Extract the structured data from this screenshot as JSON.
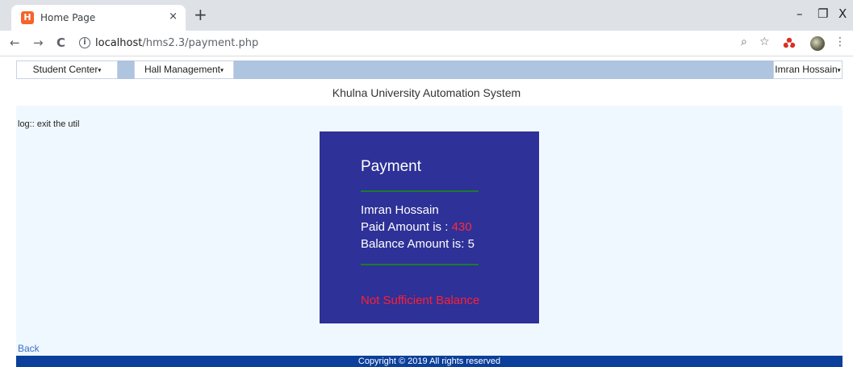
{
  "browser": {
    "tab_title": "Home Page",
    "tab_close": "×",
    "new_tab": "+",
    "favicon_text": "H",
    "url_host": "localhost",
    "url_path": "/hms2.3/payment.php",
    "window_minimize": "–",
    "window_restore": "❐",
    "window_close": "X",
    "back": "←",
    "forward": "→",
    "reload": "C",
    "info": "i",
    "zoom": "⌕",
    "star": "☆",
    "menu": "⋮"
  },
  "navbar": {
    "student_center": "Student Center",
    "hall_management": "Hall Management",
    "user": "Imran Hossain",
    "caret": "▾"
  },
  "site_title": "Khulna University Automation System",
  "log_text": "log:: exit the util",
  "payment": {
    "title": "Payment",
    "name": "Imran Hossain",
    "paid_label": "Paid Amount is : ",
    "paid_value": "430",
    "balance_label": "Balance Amount is: ",
    "balance_value": "5",
    "error": "Not Sufficient Balance"
  },
  "back_link": "Back",
  "footer": "Copyright © 2019 All rights reserved",
  "colors": {
    "card_bg": "#2e3197",
    "navbar_bg": "#afc4df",
    "footer_bg": "#0a3f9b",
    "error_red": "#ff1f33"
  }
}
